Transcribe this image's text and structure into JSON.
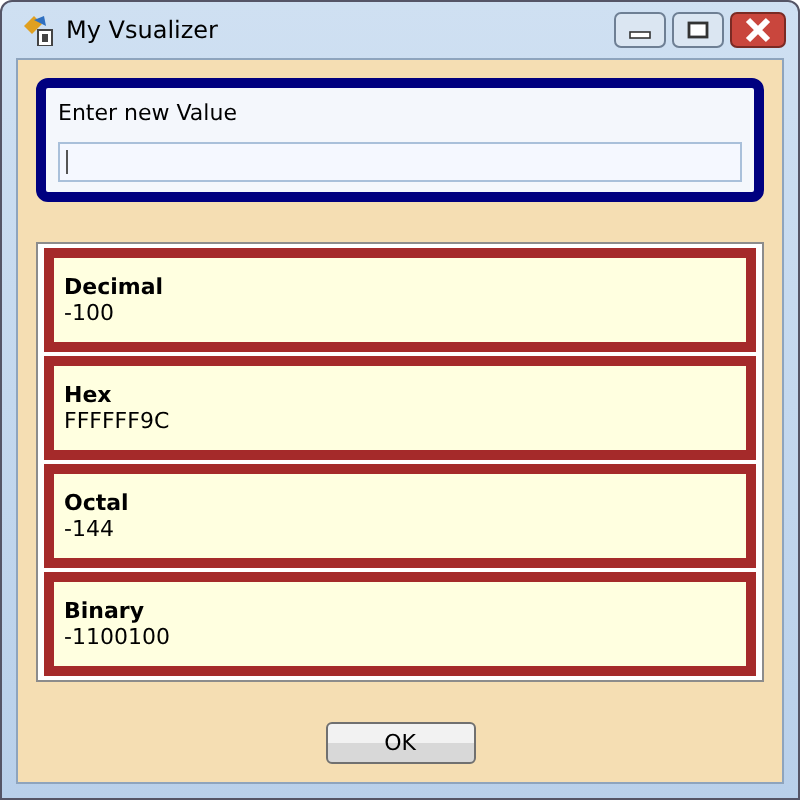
{
  "window": {
    "title": "My Vsualizer"
  },
  "input_panel": {
    "label": "Enter new Value"
  },
  "conversions": [
    {
      "name": "Decimal",
      "value": "-100"
    },
    {
      "name": "Hex",
      "value": "FFFFFF9C"
    },
    {
      "name": "Octal",
      "value": "-144"
    },
    {
      "name": "Binary",
      "value": "-1100100"
    }
  ],
  "buttons": [
    "OK"
  ]
}
